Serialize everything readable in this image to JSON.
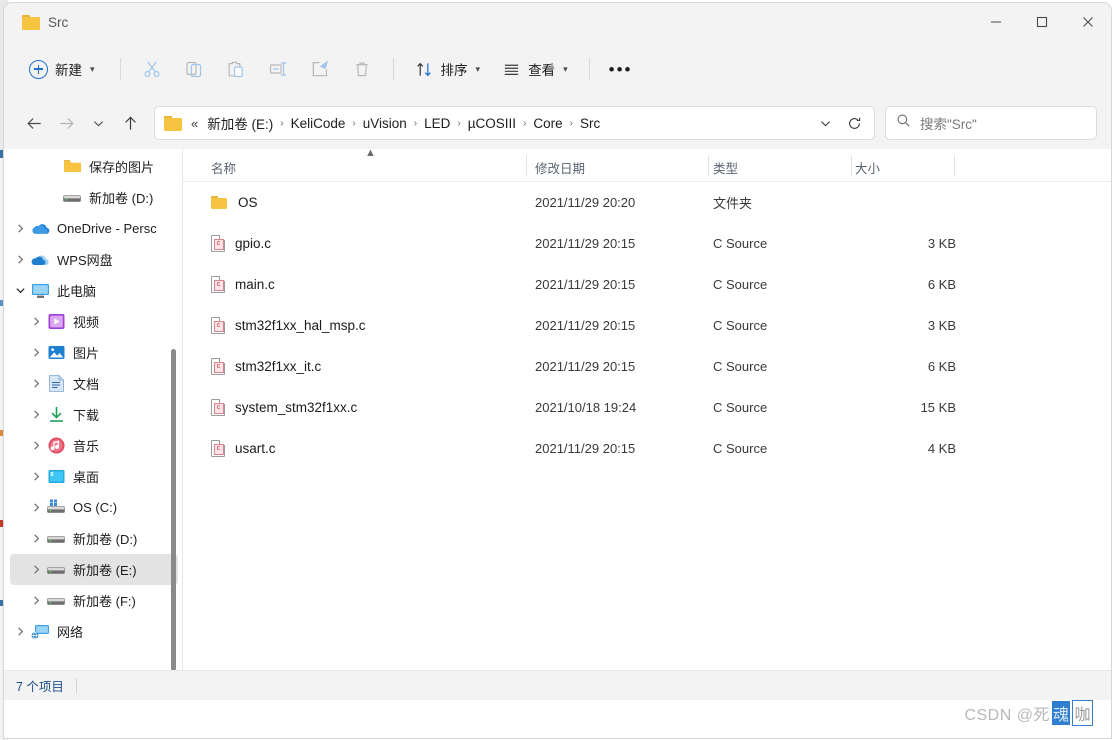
{
  "window": {
    "tab_title": "Src",
    "folder_icon": "folder-icon",
    "controls": {
      "minimize": "minimize-icon",
      "maximize": "maximize-icon",
      "close": "close-icon"
    }
  },
  "commandbar": {
    "new_label": "新建",
    "sort_label": "排序",
    "view_label": "查看",
    "more_label": "···",
    "icons": {
      "cut": "cut-icon",
      "copy": "copy-icon",
      "paste": "paste-icon",
      "rename": "rename-icon",
      "share": "share-icon",
      "delete": "trash-icon",
      "sort": "sort-arrows-icon",
      "view": "list-lines-icon",
      "more": "ellipsis-icon"
    }
  },
  "navigation": {
    "back": "back-arrow-icon",
    "forward": "forward-arrow-icon",
    "history": "chevron-down-icon",
    "up": "up-arrow-icon",
    "refresh": "refresh-icon",
    "address_ellipsis": "«",
    "crumbs": [
      "新加卷 (E:)",
      "KeliCode",
      "uVision",
      "LED",
      "µCOSIII",
      "Core",
      "Src"
    ],
    "separator": "›"
  },
  "search": {
    "placeholder": "搜索\"Src\"",
    "icon": "search-icon"
  },
  "sidebar": {
    "scroll_thumb": true,
    "items": [
      {
        "label": "保存的图片",
        "icon": "folder-icon",
        "indent": 2,
        "twisty": "",
        "selected": false
      },
      {
        "label": "新加卷 (D:)",
        "icon": "drive-icon",
        "indent": 2,
        "twisty": "",
        "selected": false
      },
      {
        "label": "OneDrive - Persc",
        "icon": "onedrive-icon",
        "indent": 0,
        "twisty": "›",
        "selected": false
      },
      {
        "label": "WPS网盘",
        "icon": "wpscloud-icon",
        "indent": 0,
        "twisty": "›",
        "selected": false
      },
      {
        "label": "此电脑",
        "icon": "thispc-icon",
        "indent": 0,
        "twisty": "⌄",
        "selected": false
      },
      {
        "label": "视频",
        "icon": "video-icon",
        "indent": 1,
        "twisty": "›",
        "selected": false
      },
      {
        "label": "图片",
        "icon": "pictures-icon",
        "indent": 1,
        "twisty": "›",
        "selected": false
      },
      {
        "label": "文档",
        "icon": "documents-icon",
        "indent": 1,
        "twisty": "›",
        "selected": false
      },
      {
        "label": "下载",
        "icon": "downloads-icon",
        "indent": 1,
        "twisty": "›",
        "selected": false
      },
      {
        "label": "音乐",
        "icon": "music-icon",
        "indent": 1,
        "twisty": "›",
        "selected": false
      },
      {
        "label": "桌面",
        "icon": "desktop-icon",
        "indent": 1,
        "twisty": "›",
        "selected": false
      },
      {
        "label": "OS (C:)",
        "icon": "osdrive-icon",
        "indent": 1,
        "twisty": "›",
        "selected": false
      },
      {
        "label": "新加卷 (D:)",
        "icon": "drive-icon",
        "indent": 1,
        "twisty": "›",
        "selected": false
      },
      {
        "label": "新加卷 (E:)",
        "icon": "drive-icon",
        "indent": 1,
        "twisty": "›",
        "selected": true
      },
      {
        "label": "新加卷 (F:)",
        "icon": "drive-icon",
        "indent": 1,
        "twisty": "›",
        "selected": false
      },
      {
        "label": "网络",
        "icon": "network-icon",
        "indent": 0,
        "twisty": "›",
        "selected": false
      }
    ]
  },
  "filelist": {
    "columns": [
      "名称",
      "修改日期",
      "类型",
      "大小"
    ],
    "sort_column": "名称",
    "sort_direction": "ascending",
    "rows": [
      {
        "name": "OS",
        "date": "2021/11/29 20:20",
        "type": "文件夹",
        "size": "",
        "icon": "folder-icon"
      },
      {
        "name": "gpio.c",
        "date": "2021/11/29 20:15",
        "type": "C Source",
        "size": "3 KB",
        "icon": "c-source-icon"
      },
      {
        "name": "main.c",
        "date": "2021/11/29 20:15",
        "type": "C Source",
        "size": "6 KB",
        "icon": "c-source-icon"
      },
      {
        "name": "stm32f1xx_hal_msp.c",
        "date": "2021/11/29 20:15",
        "type": "C Source",
        "size": "3 KB",
        "icon": "c-source-icon"
      },
      {
        "name": "stm32f1xx_it.c",
        "date": "2021/11/29 20:15",
        "type": "C Source",
        "size": "6 KB",
        "icon": "c-source-icon"
      },
      {
        "name": "system_stm32f1xx.c",
        "date": "2021/10/18 19:24",
        "type": "C Source",
        "size": "15 KB",
        "icon": "c-source-icon"
      },
      {
        "name": "usart.c",
        "date": "2021/11/29 20:15",
        "type": "C Source",
        "size": "4 KB",
        "icon": "c-source-icon"
      }
    ]
  },
  "statusbar": {
    "item_count": "7 个项目"
  },
  "watermark": {
    "prefix": "CSDN @死",
    "highlight": "魂",
    "boxed": "咖"
  },
  "colors": {
    "accent": "#1f6fd0",
    "chrome": "#f3f3f3",
    "selection": "#e3e3e3",
    "status_text": "#1c4f8c",
    "folder_yellow": "#f7c442"
  }
}
